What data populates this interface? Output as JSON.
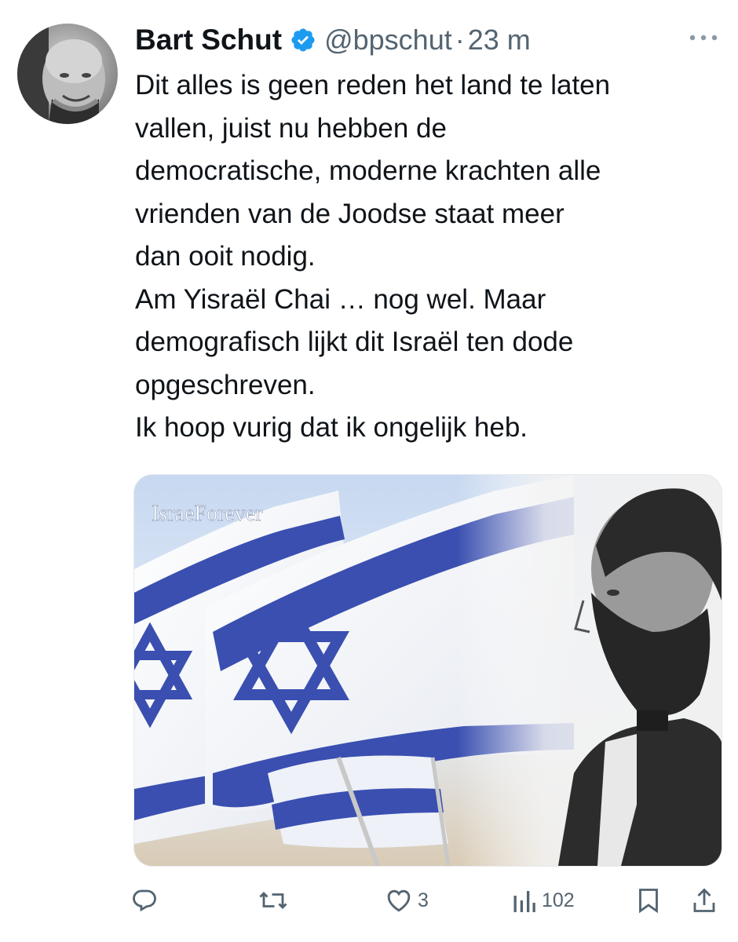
{
  "author": {
    "name": "Bart Schut",
    "handle": "@bpschut",
    "separator": "·",
    "time": "23 m"
  },
  "tweet": {
    "lines": [
      "Dit alles is geen reden het land te laten",
      "vallen, juist nu hebben de",
      "democratische, moderne krachten alle",
      "vrienden van de Joodse staat meer",
      "dan ooit nodig.",
      "Am Yisraël Chai … nog wel. Maar",
      "demografisch lijkt dit Israël ten dode",
      "opgeschreven.",
      "Ik hoop vurig dat ik ongelijk heb."
    ]
  },
  "media": {
    "logo_text": "IsraeForever"
  },
  "actions": {
    "reply_icon": "reply-icon",
    "retweet_icon": "retweet-icon",
    "like_icon": "heart-icon",
    "like_count": "3",
    "views_icon": "views-bar-chart-icon",
    "views_count": "102",
    "bookmark_icon": "bookmark-icon",
    "share_icon": "share-icon"
  },
  "colors": {
    "text": "#0f1419",
    "secondary": "#536471",
    "verified": "#1d9bf0",
    "flag_blue": "#3a4fb0"
  }
}
